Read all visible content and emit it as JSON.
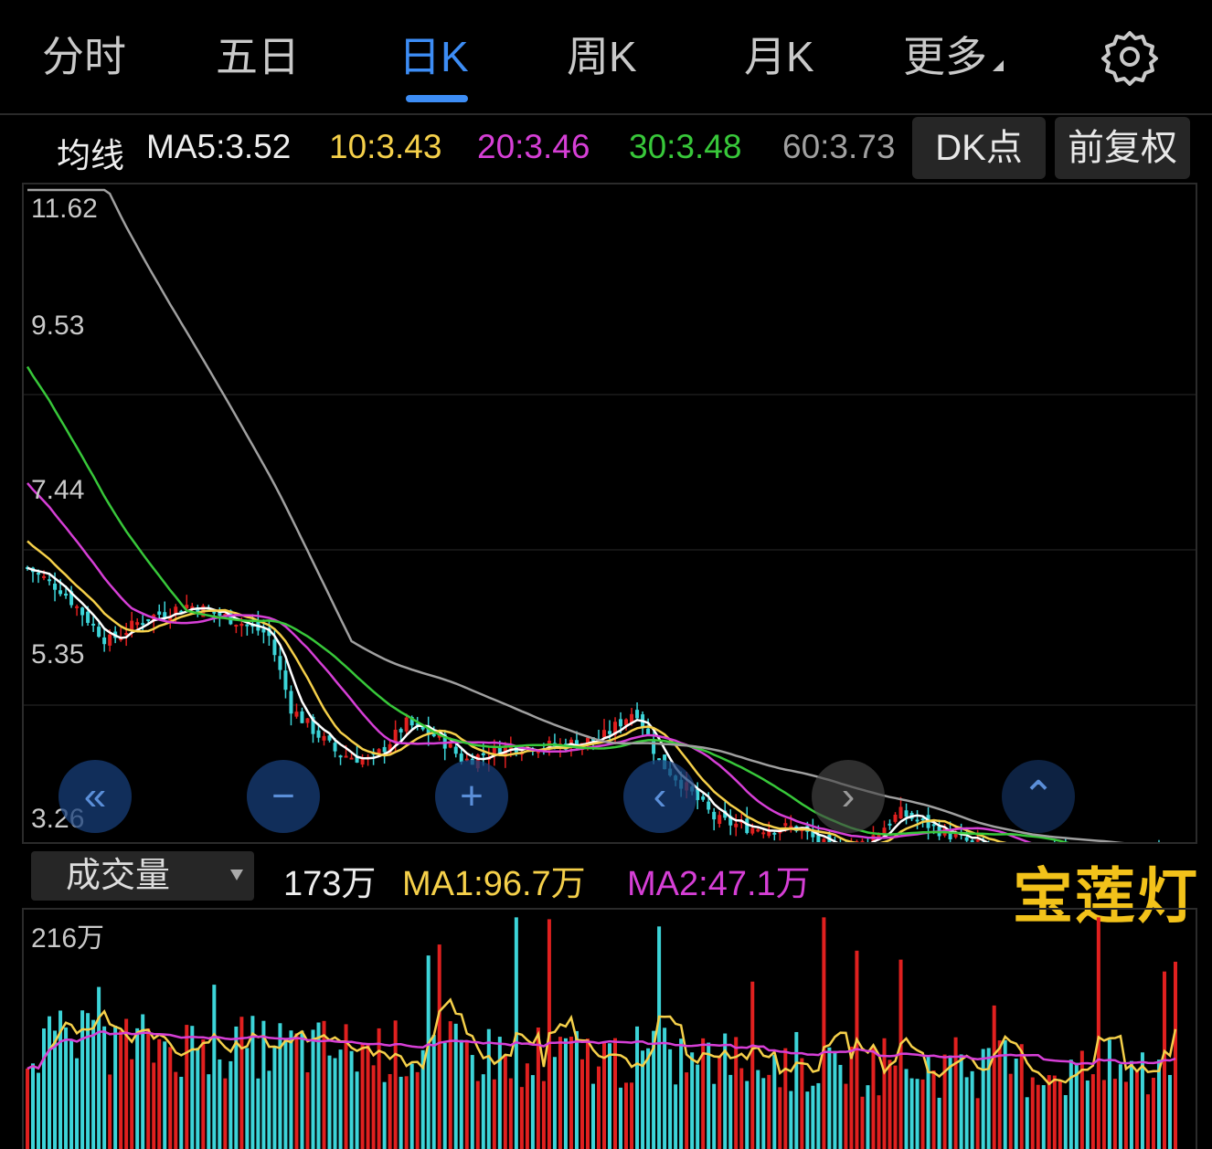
{
  "tabs": [
    {
      "label": "分时",
      "active": false
    },
    {
      "label": "五日",
      "active": false
    },
    {
      "label": "日K",
      "active": true
    },
    {
      "label": "周K",
      "active": false
    },
    {
      "label": "月K",
      "active": false
    },
    {
      "label": "更多",
      "active": false
    }
  ],
  "settings_icon": "gear-icon",
  "ma_legend": {
    "prefix": "均线",
    "ma5": "MA5:3.52",
    "ma10": "10:3.43",
    "ma20": "20:3.46",
    "ma30": "30:3.48",
    "ma60": "60:3.73"
  },
  "buttons": {
    "dk_point": "DK点",
    "adjust": "前复权"
  },
  "colors": {
    "ma5": "#ffffff",
    "ma10": "#f5d04a",
    "ma20": "#d63fd6",
    "ma30": "#38c83a",
    "ma60": "#a0a0a0",
    "up": "#e0201f",
    "down": "#3cd4d8",
    "accent": "#3d8df5",
    "brand": "#f2c21a"
  },
  "navigation": [
    {
      "icon": "double-chevron-left-icon",
      "glyph": "«"
    },
    {
      "icon": "minus-icon",
      "glyph": "−"
    },
    {
      "icon": "plus-icon",
      "glyph": "+"
    },
    {
      "icon": "chevron-left-icon",
      "glyph": "‹"
    },
    {
      "icon": "chevron-right-icon",
      "glyph": "›"
    },
    {
      "icon": "chevron-up-icon",
      "glyph": "⌃"
    }
  ],
  "volume": {
    "selector": "成交量",
    "current": "173万",
    "ma1": "MA1:96.7万",
    "ma2": "MA2:47.1万"
  },
  "brand_text": "宝莲灯",
  "chart_data": [
    {
      "type": "candlestick",
      "y_ticks": [
        "11.62",
        "9.53",
        "7.44",
        "5.35",
        "3.26"
      ],
      "ylim": [
        3.26,
        11.62
      ],
      "series": [
        {
          "name": "MA5",
          "last": 3.52
        },
        {
          "name": "MA10",
          "last": 3.43
        },
        {
          "name": "MA20",
          "last": 3.46
        },
        {
          "name": "MA30",
          "last": 3.48
        },
        {
          "name": "MA60",
          "last": 3.73
        }
      ]
    },
    {
      "type": "bar",
      "y_ticks": [
        "216万"
      ],
      "ylim": [
        0,
        216
      ],
      "series": [
        {
          "name": "MA1",
          "last": 96.7
        },
        {
          "name": "MA2",
          "last": 47.1
        }
      ],
      "current": 173
    }
  ]
}
